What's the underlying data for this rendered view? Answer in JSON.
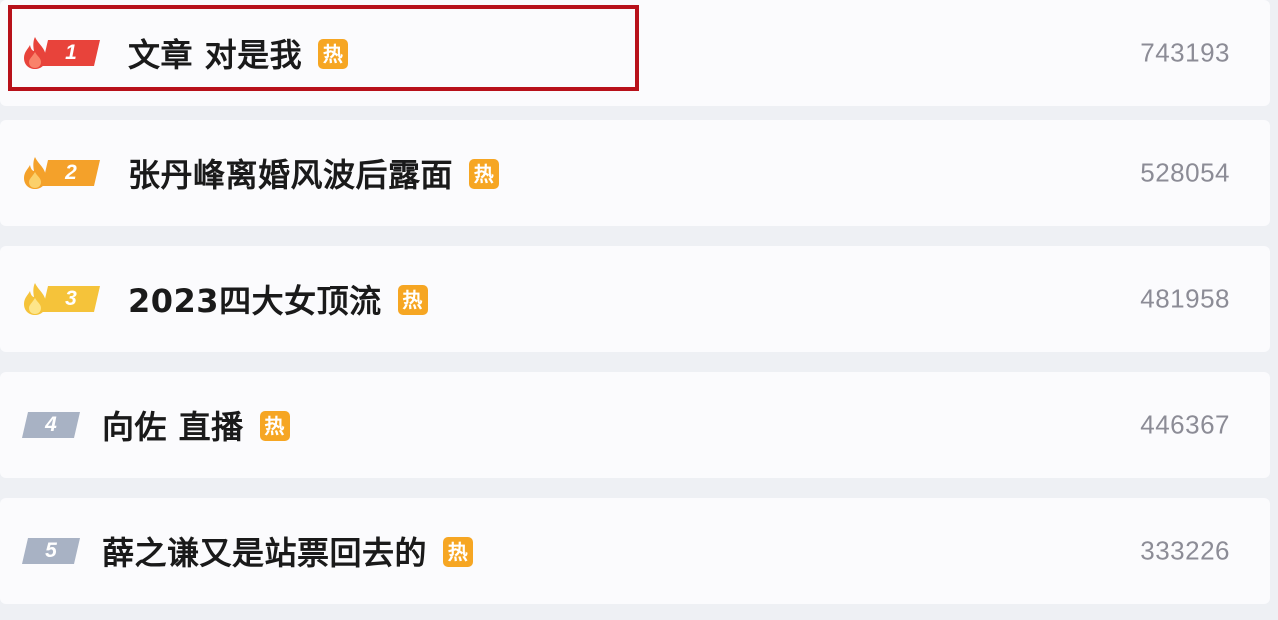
{
  "hot_search": {
    "hot_tag": "热",
    "items": [
      {
        "rank": "1",
        "title": "文章 对是我",
        "count": "743193"
      },
      {
        "rank": "2",
        "title": "张丹峰离婚风波后露面",
        "count": "528054"
      },
      {
        "rank": "3",
        "title": "2023四大女顶流",
        "count": "481958"
      },
      {
        "rank": "4",
        "title": "向佐 直播",
        "count": "446367"
      },
      {
        "rank": "5",
        "title": "薛之谦又是站票回去的",
        "count": "333226"
      }
    ]
  },
  "colors": {
    "rank1": "#e8433b",
    "rank2": "#f4a12a",
    "rank3": "#f5c33a",
    "rank_other": "#a8b2c4",
    "hot_tag": "#f6a623",
    "highlight_border": "#b8111a"
  }
}
